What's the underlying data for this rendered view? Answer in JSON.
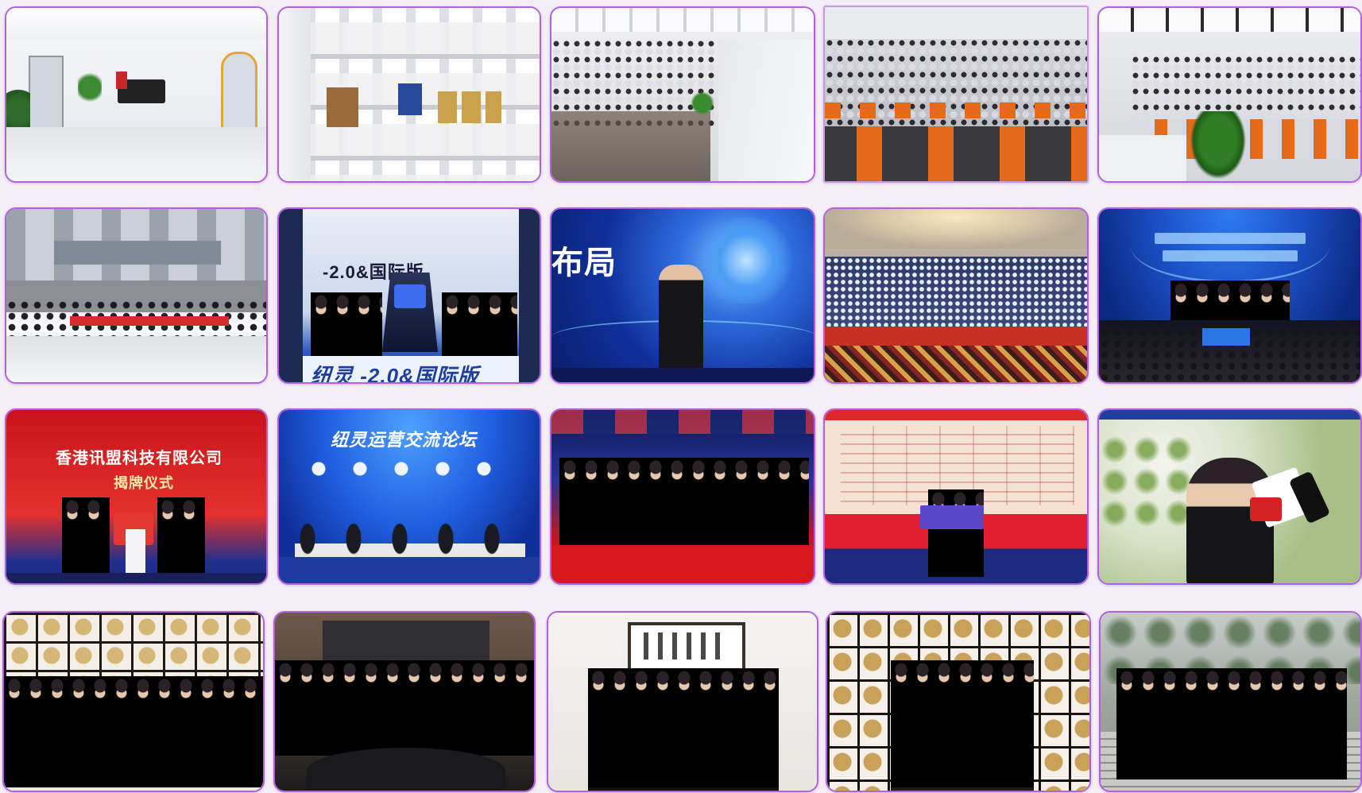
{
  "gallery": {
    "accent": "#b25fe0",
    "background": "#f4eef6",
    "photos": [
      {
        "scene": "office-reception"
      },
      {
        "scene": "certificate-wall"
      },
      {
        "scene": "open-office"
      },
      {
        "scene": "open-office-orange-chairs"
      },
      {
        "scene": "open-office-plant"
      },
      {
        "scene": "company-group-photo-outdoor"
      },
      {
        "scene": "stage-launch",
        "banner": "-2.0&国际版",
        "subbanner": "纽灵  -2.0&国际版"
      },
      {
        "scene": "speaker-stage",
        "banner": "布局"
      },
      {
        "scene": "ballroom-crowd"
      },
      {
        "scene": "signing-ceremony-blue"
      },
      {
        "scene": "red-stage-ceremony",
        "banner": "香港讯盟科技有限公司",
        "subbanner": "揭牌仪式"
      },
      {
        "scene": "forum-panel",
        "banner": "纽灵运营交流论坛"
      },
      {
        "scene": "award-stage-red"
      },
      {
        "scene": "award-presentation"
      },
      {
        "scene": "media-interview"
      },
      {
        "scene": "group-certificate-room"
      },
      {
        "scene": "group-meeting-room"
      },
      {
        "scene": "group-calligraphy-room"
      },
      {
        "scene": "group-honor-wall"
      },
      {
        "scene": "group-outdoor-steps"
      }
    ]
  }
}
